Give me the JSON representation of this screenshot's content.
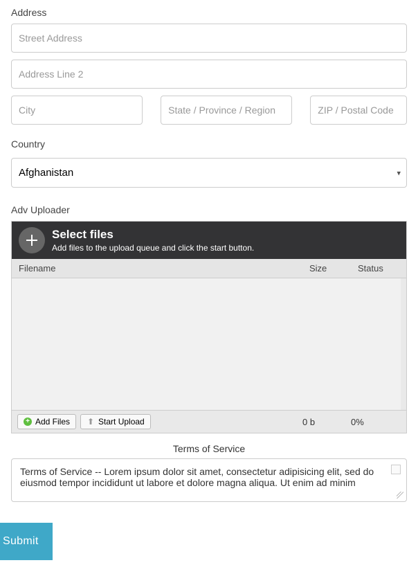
{
  "address": {
    "label": "Address",
    "street_placeholder": "Street Address",
    "line2_placeholder": "Address Line 2",
    "city_placeholder": "City",
    "state_placeholder": "State / Province / Region",
    "zip_placeholder": "ZIP / Postal Code"
  },
  "country": {
    "label": "Country",
    "selected": "Afghanistan"
  },
  "uploader": {
    "section_label": "Adv Uploader",
    "title": "Select files",
    "subtitle": "Add files to the upload queue and click the start button.",
    "col_filename": "Filename",
    "col_size": "Size",
    "col_status": "Status",
    "add_files_label": "Add Files",
    "start_upload_label": "Start Upload",
    "footer_size": "0 b",
    "footer_status": "0%"
  },
  "tos": {
    "label": "Terms of Service",
    "text": "Terms of Service -- Lorem ipsum dolor sit amet, consectetur adipisicing elit, sed do eiusmod tempor incididunt ut labore et dolore magna aliqua. Ut enim ad minim"
  },
  "submit": {
    "label": "Submit"
  }
}
